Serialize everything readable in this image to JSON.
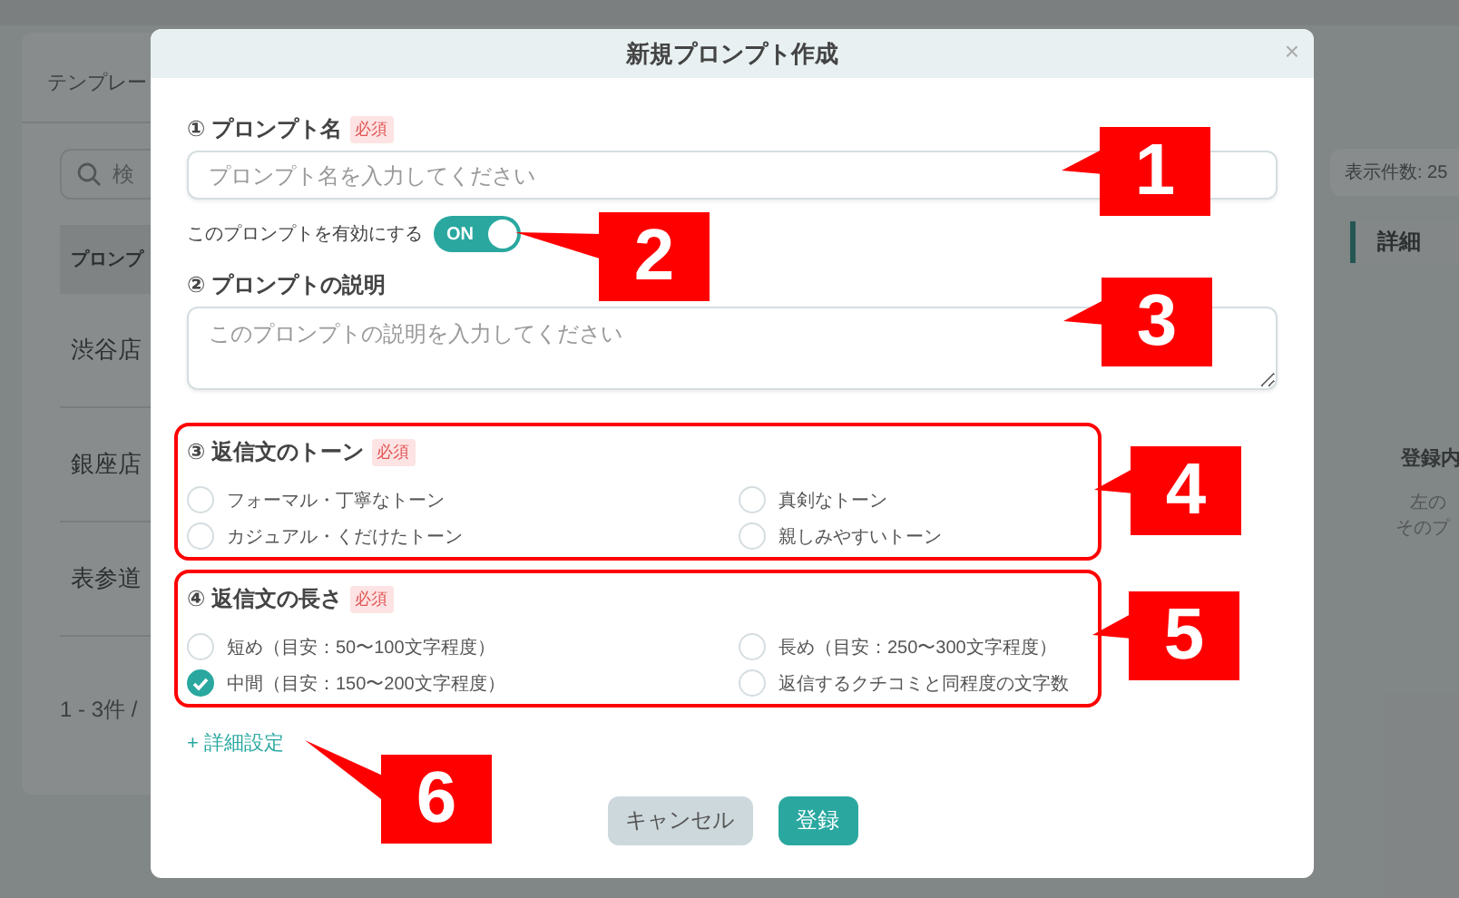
{
  "background": {
    "card_title": "テンプレー",
    "search_placeholder": "検",
    "column_header": "プロンプ",
    "rows": [
      "渋谷店",
      "銀座店",
      "表参道"
    ],
    "pagination": "1 - 3件 /",
    "page_size": "表示件数: 25",
    "detail_title": "詳細",
    "empty_title": "登録内",
    "empty_text": [
      "左の",
      "そのプ"
    ]
  },
  "modal": {
    "title": "新規プロンプト作成",
    "close": "×",
    "name_field": {
      "label": "① プロンプト名",
      "required": "必須",
      "placeholder": "プロンプト名を入力してください"
    },
    "toggle": {
      "label": "このプロンプトを有効にする",
      "on": true,
      "text": "ON"
    },
    "description_field": {
      "label": "② プロンプトの説明",
      "placeholder": "このプロンプトの説明を入力してください"
    },
    "groups": [
      {
        "label": "③ 返信文のトーン",
        "required": "必須",
        "highlighted": true,
        "options": [
          {
            "label": "フォーマル・丁寧なトーン",
            "selected": false
          },
          {
            "label": "真剣なトーン",
            "selected": false
          },
          {
            "label": "カジュアル・くだけたトーン",
            "selected": false
          },
          {
            "label": "親しみやすいトーン",
            "selected": false
          }
        ]
      },
      {
        "label": "④ 返信文の長さ",
        "required": "必須",
        "highlighted": true,
        "options": [
          {
            "label": "短め（目安：50〜100文字程度）",
            "selected": false
          },
          {
            "label": "長め（目安：250〜300文字程度）",
            "selected": false
          },
          {
            "label": "中間（目安：150〜200文字程度）",
            "selected": true
          },
          {
            "label": "返信するクチコミと同程度の文字数",
            "selected": false
          }
        ]
      }
    ],
    "advanced_link": "+ 詳細設定",
    "buttons": [
      {
        "label": "キャンセル",
        "kind": "secondary"
      },
      {
        "label": "登録",
        "kind": "primary"
      }
    ]
  },
  "callouts": [
    {
      "number": "1"
    },
    {
      "number": "2"
    },
    {
      "number": "3"
    },
    {
      "number": "4"
    },
    {
      "number": "5"
    },
    {
      "number": "6"
    }
  ]
}
